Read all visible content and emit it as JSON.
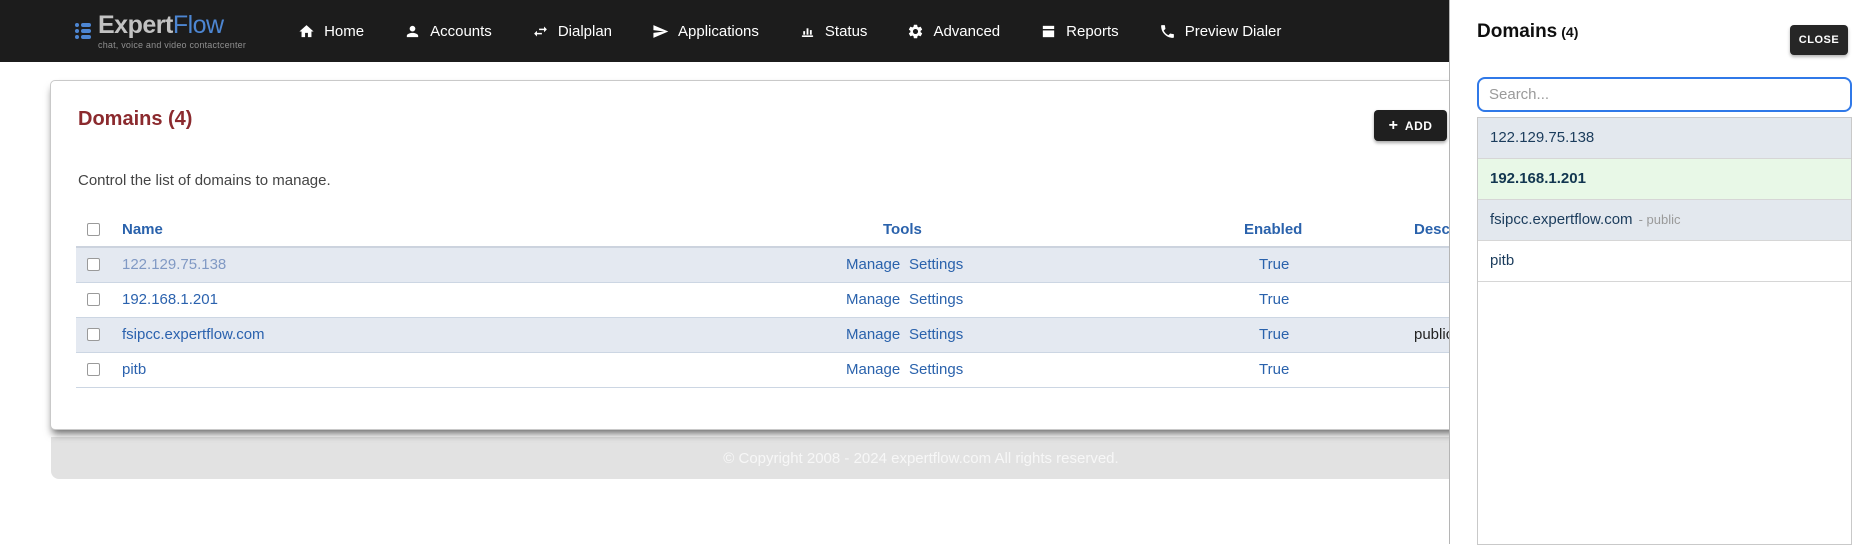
{
  "brand": {
    "name_primary": "Expert",
    "name_secondary": "Flow",
    "tagline": "chat, voice and video contactcenter"
  },
  "nav": {
    "items": [
      {
        "label": "Home",
        "icon": "home-icon"
      },
      {
        "label": "Accounts",
        "icon": "person-icon"
      },
      {
        "label": "Dialplan",
        "icon": "swap-arrows-icon"
      },
      {
        "label": "Applications",
        "icon": "paper-plane-icon"
      },
      {
        "label": "Status",
        "icon": "bar-chart-icon"
      },
      {
        "label": "Advanced",
        "icon": "gear-icon"
      },
      {
        "label": "Reports",
        "icon": "archive-box-icon"
      },
      {
        "label": "Preview Dialer",
        "icon": "phone-icon"
      }
    ]
  },
  "page": {
    "title": "Domains (4)",
    "subtitle": "Control the list of domains to manage.",
    "add_button": {
      "label": "ADD",
      "icon_glyph": "+"
    },
    "table": {
      "columns": [
        "Name",
        "Tools",
        "Enabled",
        "Description"
      ],
      "rows": [
        {
          "name": "122.129.75.138",
          "tools": [
            "Manage",
            "Settings"
          ],
          "enabled": "True",
          "description": ""
        },
        {
          "name": "192.168.1.201",
          "tools": [
            "Manage",
            "Settings"
          ],
          "enabled": "True",
          "description": ""
        },
        {
          "name": "fsipcc.expertflow.com",
          "tools": [
            "Manage",
            "Settings"
          ],
          "enabled": "True",
          "description": "public"
        },
        {
          "name": "pitb",
          "tools": [
            "Manage",
            "Settings"
          ],
          "enabled": "True",
          "description": ""
        }
      ]
    },
    "footer": "© Copyright 2008 - 2024 expertflow.com All rights reserved."
  },
  "panel": {
    "title": "Domains",
    "count": "(4)",
    "close_label": "CLOSE",
    "search_placeholder": "Search...",
    "items": [
      {
        "label": "122.129.75.138",
        "suffix": "",
        "state": "normal"
      },
      {
        "label": "192.168.1.201",
        "suffix": "",
        "state": "active"
      },
      {
        "label": "fsipcc.expertflow.com",
        "suffix": "- public",
        "state": "normal"
      },
      {
        "label": "pitb",
        "suffix": "",
        "state": "plain"
      }
    ]
  },
  "colors": {
    "navbar_bg": "#1c1c1c",
    "brand_blue": "#4d86d2",
    "heading_red": "#8b2a2e",
    "link_blue": "#2a62ac",
    "row_stripe_bg": "#e4e9f1",
    "active_domain_bg": "#e8f8e7",
    "search_focus_border": "#3079e8"
  }
}
